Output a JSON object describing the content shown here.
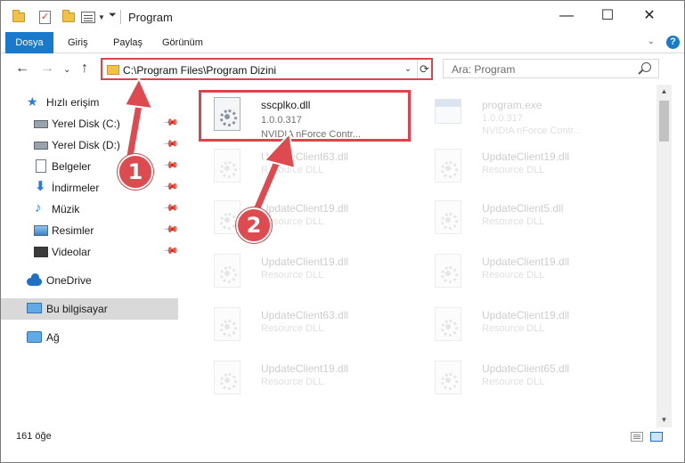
{
  "window": {
    "title": "Program",
    "minimize": "—",
    "maximize": "☐",
    "close": "✕"
  },
  "ribbon": {
    "tabs": [
      "Dosya",
      "Giriş",
      "Paylaş",
      "Görünüm"
    ],
    "help": "?"
  },
  "nav": {
    "back": "←",
    "forward": "→",
    "recent": "⌄",
    "up": "↑",
    "address": "C:\\Program Files\\Program Dizini",
    "dropdown": "⌄",
    "refresh": "⟳",
    "search_placeholder": "Ara: Program"
  },
  "sidebar": {
    "quick_access": "Hızlı erişim",
    "items": [
      {
        "label": "Yerel Disk (C:)",
        "icon": "disk-icon"
      },
      {
        "label": "Yerel Disk (D:)",
        "icon": "disk-icon"
      },
      {
        "label": "Belgeler",
        "icon": "documents-icon"
      },
      {
        "label": "İndirmeler",
        "icon": "download-icon"
      },
      {
        "label": "Müzik",
        "icon": "music-icon"
      },
      {
        "label": "Resimler",
        "icon": "pictures-icon"
      },
      {
        "label": "Videolar",
        "icon": "videos-icon"
      }
    ],
    "onedrive": "OneDrive",
    "this_pc": "Bu bilgisayar",
    "network": "Ağ"
  },
  "files": {
    "highlighted": {
      "name": "sscplko.dll",
      "version": "1.0.0.317",
      "description": "NVIDIA nForce Contr..."
    },
    "program_exe": {
      "name": "program.exe",
      "version": "1.0.0.317",
      "description": "NVIDIA nForce Contr..."
    },
    "grid": [
      {
        "name": "UpdateClient63.dll",
        "type": "Resource DLL"
      },
      {
        "name": "UpdateClient19.dll",
        "type": "Resource DLL"
      },
      {
        "name": "UpdateClient19.dll",
        "type": "Resource DLL"
      },
      {
        "name": "UpdateClient5.dll",
        "type": "Resource DLL"
      },
      {
        "name": "UpdateClient19.dll",
        "type": "Resource DLL"
      },
      {
        "name": "UpdateClient19.dll",
        "type": "Resource DLL"
      },
      {
        "name": "UpdateClient63.dll",
        "type": "Resource DLL"
      },
      {
        "name": "UpdateClient19.dll",
        "type": "Resource DLL"
      },
      {
        "name": "UpdateClient19.dll",
        "type": "Resource DLL"
      },
      {
        "name": "UpdateClient65.dll",
        "type": "Resource DLL"
      }
    ]
  },
  "status": {
    "item_count": "161 öğe"
  },
  "annotations": {
    "badge1": "1",
    "badge2": "2",
    "color": "#dd4a4f"
  }
}
